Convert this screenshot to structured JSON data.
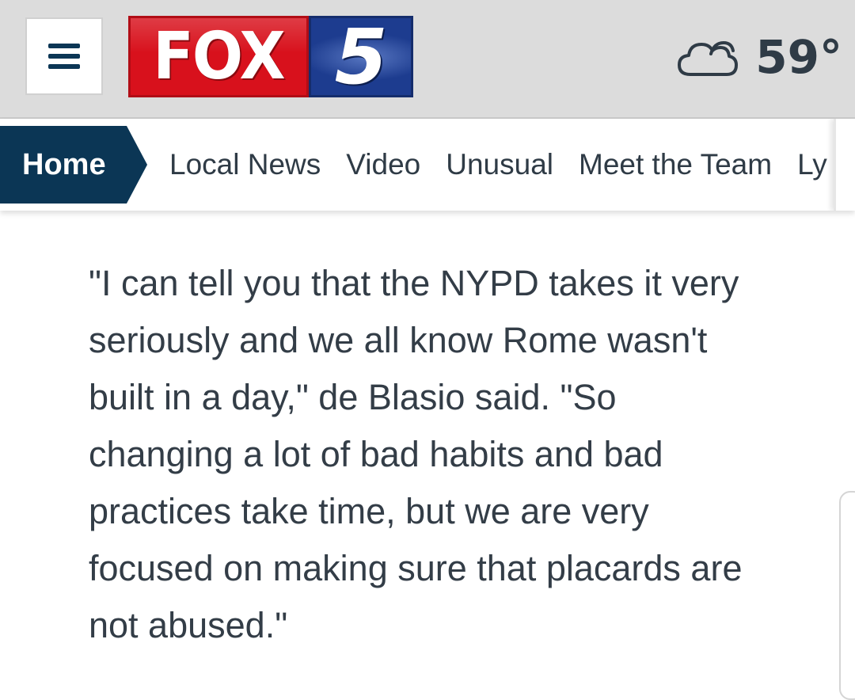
{
  "header": {
    "menu_icon": "hamburger-menu-icon",
    "logo": {
      "part1": "FOX",
      "part2": "5",
      "colors": {
        "red": "#d8111c",
        "blue": "#1d3c8f"
      }
    },
    "weather": {
      "icon": "cloud-icon",
      "temperature": "59°"
    }
  },
  "nav": {
    "active": "Home",
    "items": [
      "Local News",
      "Video",
      "Unusual",
      "Meet the Team",
      "Ly"
    ],
    "colors": {
      "active_bg": "#0b3655"
    }
  },
  "article": {
    "paragraph": "\"I can tell you that the NYPD takes it very seriously and we all know Rome wasn't built in a day,\" de Blasio said. \"So changing a lot of bad habits and bad practices take time, but we are very focused on making sure that placards are not abused.\""
  }
}
